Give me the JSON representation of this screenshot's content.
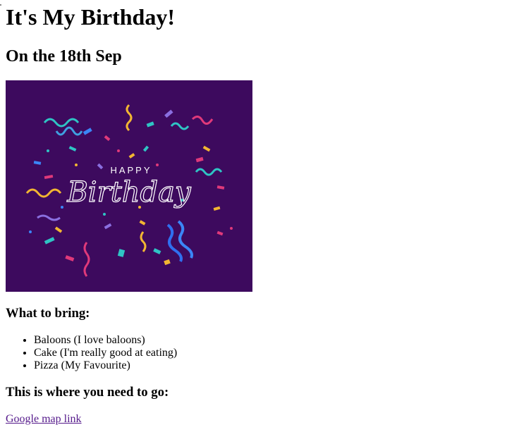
{
  "page": {
    "title": "It's My Birthday!",
    "date_heading": "On the 18th Sep"
  },
  "banner": {
    "happy_text": "HAPPY",
    "birthday_text": "Birthday",
    "background_color": "#3d0a5e"
  },
  "bring_section": {
    "heading": "What to bring:",
    "items": [
      "Baloons (I love baloons)",
      "Cake (I'm really good at eating)",
      "Pizza (My Favourite)"
    ]
  },
  "location_section": {
    "heading": "This is where you need to go:",
    "link_text": "Google map link",
    "link_color": "#551a8b"
  }
}
